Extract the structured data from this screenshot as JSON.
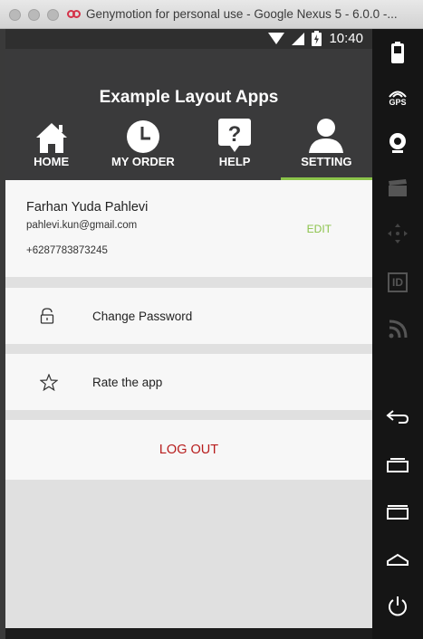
{
  "window": {
    "title": "Genymotion for personal use - Google Nexus 5 - 6.0.0 -..."
  },
  "statusbar": {
    "time": "10:40"
  },
  "appbar": {
    "title": "Example Layout Apps",
    "tabs": [
      {
        "label": "HOME",
        "icon": "home-icon"
      },
      {
        "label": "MY ORDER",
        "icon": "clock-icon"
      },
      {
        "label": "HELP",
        "icon": "help-icon"
      },
      {
        "label": "SETTING",
        "icon": "user-icon",
        "selected": true
      }
    ],
    "indicator_color": "#8bc34a"
  },
  "profile": {
    "name": "Farhan Yuda Pahlevi",
    "email": "pahlevi.kun@gmail.com",
    "phone": "+6287783873245",
    "edit_label": "EDIT"
  },
  "settings": {
    "items": [
      {
        "label": "Change Password",
        "icon": "lock-icon"
      },
      {
        "label": "Rate the app",
        "icon": "star-icon"
      }
    ],
    "logout_label": "LOG OUT",
    "logout_color": "#b71c1c"
  },
  "sidebar": {
    "gps_label": "GPS",
    "id_label": "ID",
    "buttons": [
      "battery-icon",
      "gps-icon",
      "webcam-icon",
      "clapperboard-icon",
      "dpad-icon",
      "id-icon",
      "network-icon",
      "back-icon",
      "recent-apps-icon",
      "menu-icon",
      "home-icon",
      "power-icon"
    ]
  }
}
